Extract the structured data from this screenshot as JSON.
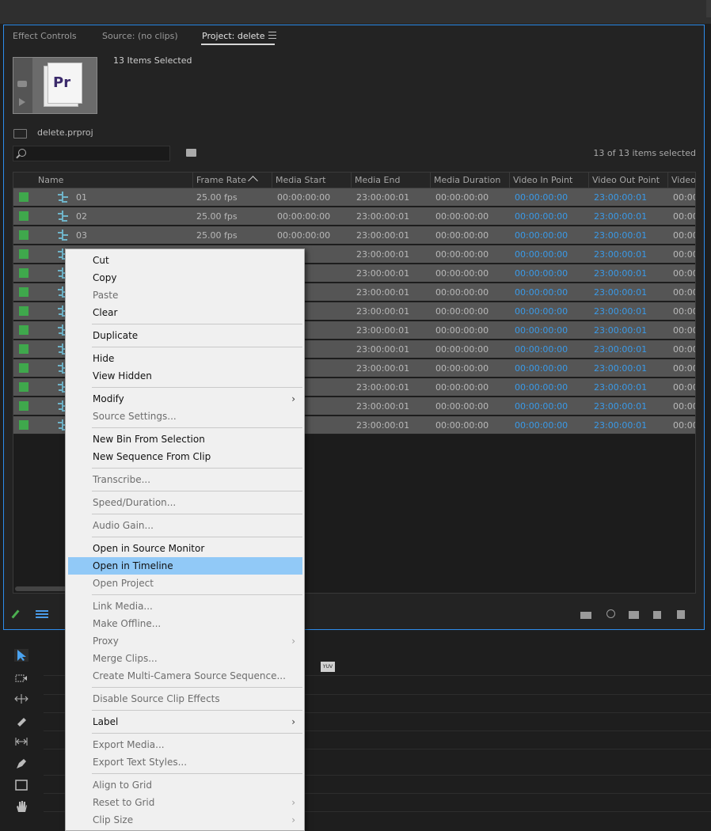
{
  "tabs": {
    "effect_controls": "Effect Controls",
    "source": "Source: (no clips)",
    "project": "Project: delete"
  },
  "project": {
    "selection_label": "13 Items Selected",
    "file_name": "delete.prproj",
    "thumb_badge": "Pr",
    "search_placeholder": "",
    "items_selected": "13 of 13 items selected"
  },
  "table": {
    "columns": [
      "Name",
      "Frame Rate",
      "Media Start",
      "Media End",
      "Media Duration",
      "Video In Point",
      "Video Out Point",
      "Video"
    ],
    "sorted_column": "Frame Rate",
    "sort_direction": "ascending",
    "rows": [
      {
        "name": "01",
        "frame_rate": "25.00 fps",
        "media_start": "00:00:00:00",
        "media_end": "23:00:00:01",
        "duration": "00:00:00:00",
        "in": "00:00:00:00",
        "out": "23:00:00:01",
        "video": "00:00"
      },
      {
        "name": "02",
        "frame_rate": "25.00 fps",
        "media_start": "00:00:00:00",
        "media_end": "23:00:00:01",
        "duration": "00:00:00:00",
        "in": "00:00:00:00",
        "out": "23:00:00:01",
        "video": "00:00"
      },
      {
        "name": "03",
        "frame_rate": "25.00 fps",
        "media_start": "00:00:00:00",
        "media_end": "23:00:00:01",
        "duration": "00:00:00:00",
        "in": "00:00:00:00",
        "out": "23:00:00:01",
        "video": "00:00"
      },
      {
        "name": "",
        "frame_rate": "",
        "media_start": "00:00",
        "media_end": "23:00:00:01",
        "duration": "00:00:00:00",
        "in": "00:00:00:00",
        "out": "23:00:00:01",
        "video": "00:00"
      },
      {
        "name": "",
        "frame_rate": "",
        "media_start": "00:00",
        "media_end": "23:00:00:01",
        "duration": "00:00:00:00",
        "in": "00:00:00:00",
        "out": "23:00:00:01",
        "video": "00:00"
      },
      {
        "name": "",
        "frame_rate": "",
        "media_start": "00:00",
        "media_end": "23:00:00:01",
        "duration": "00:00:00:00",
        "in": "00:00:00:00",
        "out": "23:00:00:01",
        "video": "00:00"
      },
      {
        "name": "",
        "frame_rate": "",
        "media_start": "00:00",
        "media_end": "23:00:00:01",
        "duration": "00:00:00:00",
        "in": "00:00:00:00",
        "out": "23:00:00:01",
        "video": "00:00"
      },
      {
        "name": "",
        "frame_rate": "",
        "media_start": "00:00",
        "media_end": "23:00:00:01",
        "duration": "00:00:00:00",
        "in": "00:00:00:00",
        "out": "23:00:00:01",
        "video": "00:00"
      },
      {
        "name": "",
        "frame_rate": "",
        "media_start": "00:00",
        "media_end": "23:00:00:01",
        "duration": "00:00:00:00",
        "in": "00:00:00:00",
        "out": "23:00:00:01",
        "video": "00:00"
      },
      {
        "name": "",
        "frame_rate": "",
        "media_start": "00:00",
        "media_end": "23:00:00:01",
        "duration": "00:00:00:00",
        "in": "00:00:00:00",
        "out": "23:00:00:01",
        "video": "00:00"
      },
      {
        "name": "",
        "frame_rate": "",
        "media_start": "00:00",
        "media_end": "23:00:00:01",
        "duration": "00:00:00:00",
        "in": "00:00:00:00",
        "out": "23:00:00:01",
        "video": "00:00"
      },
      {
        "name": "",
        "frame_rate": "",
        "media_start": "00:00",
        "media_end": "23:00:00:01",
        "duration": "00:00:00:00",
        "in": "00:00:00:00",
        "out": "23:00:00:01",
        "video": "00:00"
      },
      {
        "name": "",
        "frame_rate": "",
        "media_start": "00:00",
        "media_end": "23:00:00:01",
        "duration": "00:00:00:00",
        "in": "00:00:00:00",
        "out": "23:00:00:01",
        "video": "00:00"
      }
    ]
  },
  "timeline": {
    "yuv_badge": "YUV"
  },
  "context_menu": {
    "items": [
      {
        "label": "Cut",
        "disabled": false
      },
      {
        "label": "Copy",
        "disabled": false
      },
      {
        "label": "Paste",
        "disabled": true
      },
      {
        "label": "Clear",
        "disabled": false
      },
      {
        "separator": true
      },
      {
        "label": "Duplicate",
        "disabled": false
      },
      {
        "separator": true
      },
      {
        "label": "Hide",
        "disabled": false
      },
      {
        "label": "View Hidden",
        "disabled": false
      },
      {
        "separator": true
      },
      {
        "label": "Modify",
        "disabled": false,
        "submenu": true
      },
      {
        "label": "Source Settings...",
        "disabled": true
      },
      {
        "separator": true
      },
      {
        "label": "New Bin From Selection",
        "disabled": false
      },
      {
        "label": "New Sequence From Clip",
        "disabled": false
      },
      {
        "separator": true
      },
      {
        "label": "Transcribe...",
        "disabled": true
      },
      {
        "separator": true
      },
      {
        "label": "Speed/Duration...",
        "disabled": true
      },
      {
        "separator": true
      },
      {
        "label": "Audio Gain...",
        "disabled": true
      },
      {
        "separator": true
      },
      {
        "label": "Open in Source Monitor",
        "disabled": false
      },
      {
        "label": "Open in Timeline",
        "disabled": false,
        "highlighted": true
      },
      {
        "label": "Open Project",
        "disabled": true
      },
      {
        "separator": true
      },
      {
        "label": "Link Media...",
        "disabled": true
      },
      {
        "label": "Make Offline...",
        "disabled": true
      },
      {
        "label": "Proxy",
        "disabled": true,
        "submenu": true
      },
      {
        "label": "Merge Clips...",
        "disabled": true
      },
      {
        "label": "Create Multi-Camera Source Sequence...",
        "disabled": true
      },
      {
        "separator": true
      },
      {
        "label": "Disable Source Clip Effects",
        "disabled": true
      },
      {
        "separator": true
      },
      {
        "label": "Label",
        "disabled": false,
        "submenu": true
      },
      {
        "separator": true
      },
      {
        "label": "Export Media...",
        "disabled": true
      },
      {
        "label": "Export Text Styles...",
        "disabled": true
      },
      {
        "separator": true
      },
      {
        "label": "Align to Grid",
        "disabled": true
      },
      {
        "label": "Reset to Grid",
        "disabled": true,
        "submenu": true
      },
      {
        "label": "Clip Size",
        "disabled": true,
        "submenu": true
      }
    ]
  },
  "colors": {
    "panel_focus_border": "#2d8ceb",
    "label_green": "#3fa84c",
    "timecode_blue": "#3a9ae8",
    "menu_highlight": "#91c9f7"
  }
}
